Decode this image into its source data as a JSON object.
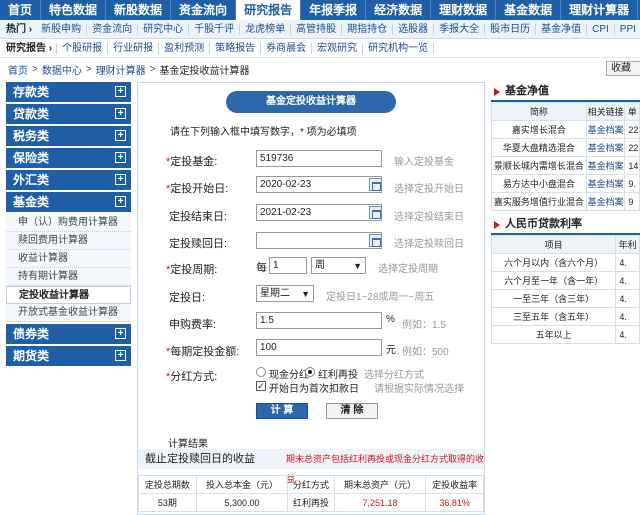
{
  "top_nav": [
    "首页",
    "特色数据",
    "新股数据",
    "资金流向",
    "研究报告",
    "年报季报",
    "经济数据",
    "理财数据",
    "基金数据",
    "理财计算器"
  ],
  "hot": {
    "label": "热门",
    "items": [
      "新股申购",
      "资金流向",
      "研究中心",
      "千股千评",
      "龙虎榜单",
      "高管持股",
      "期指持仓",
      "选股器",
      "季报大全",
      "股市日历",
      "基金净值",
      "CPI",
      "PPI"
    ]
  },
  "research": {
    "label": "研究报告",
    "items": [
      "个股研报",
      "行业研报",
      "盈利预测",
      "策略报告",
      "券商晨会",
      "宏观研究",
      "研究机构一览"
    ]
  },
  "breadcrumb": [
    "首页",
    "数据中心",
    "理财计算器",
    "基金定投收益计算器"
  ],
  "favorite_label": "收藏",
  "sidebar": {
    "groups_top": [
      "存款类",
      "贷款类",
      "税务类",
      "保险类",
      "外汇类"
    ],
    "fund_group": "基金类",
    "fund_links": [
      "申（认）购费用计算器",
      "赎回费用计算器",
      "收益计算器",
      "持有期计算器",
      "定投收益计算器",
      "开放式基金收益计算器"
    ],
    "groups_bottom": [
      "债券类",
      "期货类"
    ]
  },
  "calc": {
    "title": "基金定投收益计算器",
    "intro": "请在下列输入框中填写数字，* 项为必填项",
    "fields": {
      "fund": {
        "label": "定投基金:",
        "value": "519736",
        "hint": "输入定投基金"
      },
      "start": {
        "label": "定投开始日:",
        "value": "2020-02-23",
        "hint": "选择定投开始日"
      },
      "end": {
        "label": "定投结束日:",
        "value": "2021-02-23",
        "hint": "选择定投结束日"
      },
      "redeem": {
        "label": "定投赎回日:",
        "value": "",
        "hint": "选择定投赎回日"
      },
      "period": {
        "label": "定投周期:",
        "prefix": "每",
        "value": "1",
        "unit": "周",
        "hint": "选择定投周期"
      },
      "day": {
        "label": "定投日:",
        "value": "星期二",
        "hint": "定投日1~28或周一~周五"
      },
      "fee": {
        "label": "申购费率:",
        "value": "1.5",
        "unit": "%",
        "hint": "例如：1.5"
      },
      "amount": {
        "label": "每期定投金额:",
        "value": "100",
        "unit": "元",
        "hint": "例如：500"
      },
      "dividend": {
        "label": "分红方式:",
        "opt1": "现金分红",
        "opt2": "红利再投",
        "hint": "选择分红方式",
        "check": "开始日为首次扣款日",
        "check_hint": "请根据实际情况选择"
      }
    },
    "calc_btn": "计 算",
    "clear_btn": "清 除",
    "result_head": "计算结果",
    "result_title": "截止定投赎回日的收益",
    "result_note": "期末总资产包括红利再投或现金分红方式取得的收益",
    "result_cols": [
      "定投总期数",
      "投入总本金（元）",
      "分红方式",
      "期末总资产（元）",
      "定投收益率"
    ],
    "result_row": [
      "53期",
      "5,300.00",
      "红利再投",
      "7,251.18",
      "36.81%"
    ]
  },
  "nav_panel": {
    "title": "基金净值",
    "cols": [
      "简称",
      "相关链接",
      "单"
    ],
    "rows": [
      [
        "嘉实增长混合",
        "基金档案",
        "22"
      ],
      [
        "华夏大盘精选混合",
        "基金档案",
        "22"
      ],
      [
        "景顺长城内需增长混合",
        "基金档案",
        "14"
      ],
      [
        "易方达中小盘混合",
        "基金档案",
        "9."
      ],
      [
        "嘉实服务增值行业混合",
        "基金档案",
        "9"
      ]
    ]
  },
  "rate_panel": {
    "title": "人民币贷款利率",
    "cols": [
      "项目",
      "年利"
    ],
    "rows": [
      [
        "六个月以内（含六个月）",
        "4."
      ],
      [
        "六个月至一年（含一年）",
        "4."
      ],
      [
        "一至三年（含三年）",
        "4."
      ],
      [
        "三至五年（含五年）",
        "4."
      ],
      [
        "五年以上",
        "4."
      ]
    ]
  },
  "colors": {
    "nav_blue": "#1e5fa6",
    "required_red": "#d4151f",
    "link_blue": "#1b4f93"
  }
}
